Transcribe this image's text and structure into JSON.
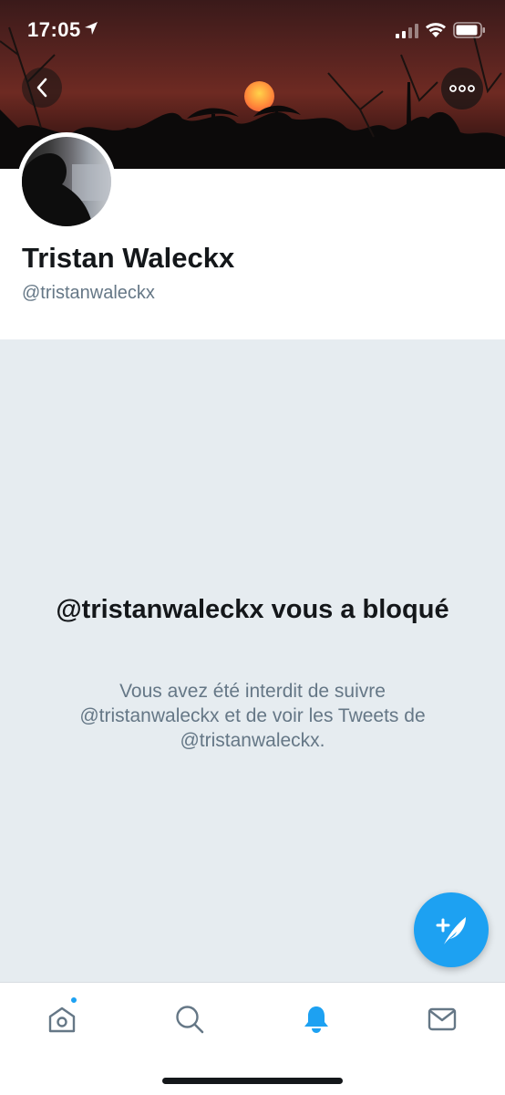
{
  "status_bar": {
    "time": "17:05",
    "icons": [
      "location-arrow-icon",
      "signal-icon",
      "wifi-icon",
      "battery-icon"
    ]
  },
  "header": {
    "back_icon": "chevron-left-icon",
    "more_icon": "more-horizontal-icon"
  },
  "profile": {
    "name": "Tristan Waleckx",
    "handle": "@tristanwaleckx"
  },
  "blocked": {
    "title": "@tristanwaleckx vous a bloqué",
    "description": "Vous avez été interdit de suivre @tristanwaleckx et de voir les Tweets de @tristanwaleckx."
  },
  "compose": {
    "icon": "compose-tweet-icon"
  },
  "tab_bar": {
    "items": [
      {
        "name": "home",
        "icon": "home-icon",
        "active": false,
        "badge": true
      },
      {
        "name": "search",
        "icon": "search-icon",
        "active": false,
        "badge": false
      },
      {
        "name": "notifications",
        "icon": "bell-icon",
        "active": true,
        "badge": false
      },
      {
        "name": "messages",
        "icon": "mail-icon",
        "active": false,
        "badge": false
      }
    ]
  },
  "colors": {
    "accent": "#1da1f2",
    "text_primary": "#14171a",
    "text_secondary": "#657786",
    "background": "#e6ecf0"
  }
}
